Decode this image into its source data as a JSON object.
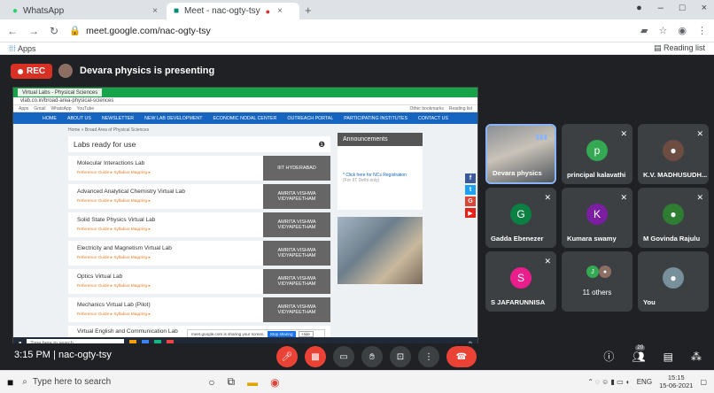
{
  "browser": {
    "tabs": [
      {
        "title": "WhatsApp",
        "close": "×"
      },
      {
        "title": "Meet - nac-ogty-tsy",
        "close": "×"
      }
    ],
    "new_tab": "+",
    "window_controls": [
      "–",
      "□",
      "×"
    ],
    "url": "meet.google.com/nac-ogty-tsy",
    "bookmarks_apps": "Apps",
    "reading_list": "Reading list"
  },
  "meet": {
    "rec_label": "REC",
    "presenting_text": "Devara physics is presenting",
    "meeting_time": "3:15 PM",
    "meeting_code": "nac-ogty-tsy",
    "people_count": "20"
  },
  "shared_screen": {
    "tab1": "Virtual Labs - Physical Sciences",
    "address": "vlab.co.in/broad-area-physical-sciences",
    "bookmarks": [
      "Apps",
      "Gmail",
      "WhatsApp",
      "YouTube",
      "Other bookmarks",
      "Reading list"
    ],
    "nav": [
      "HOME",
      "ABOUT US",
      "NEWSLETTER",
      "NEW LAB DEVELOPMENT",
      "ECONOMIC NODAL CENTER",
      "OUTREACH PORTAL",
      "PARTICIPATING INSTITUTES",
      "CONTACT US"
    ],
    "breadcrumb": "Home » Broad Area of Physical Sciences",
    "labs_title": "Labs ready for use",
    "labs": [
      {
        "name": "Molecular Interactions Lab",
        "sub": "Reference Guide ▸   Syllabus Mapping ▸",
        "institute": "IIIT HYDERABAD"
      },
      {
        "name": "Advanced Analytical Chemistry Virtual Lab",
        "sub": "Reference Guide ▸   Syllabus Mapping ▸",
        "institute": "AMRITA VISHWA VIDYAPEETHAM"
      },
      {
        "name": "Solid State Physics Virtual Lab",
        "sub": "Reference Guide ▸   Syllabus Mapping ▸",
        "institute": "AMRITA VISHWA VIDYAPEETHAM"
      },
      {
        "name": "Electricity and Magnetism Virtual Lab",
        "sub": "Reference Guide ▸   Syllabus Mapping ▸",
        "institute": "AMRITA VISHWA VIDYAPEETHAM"
      },
      {
        "name": "Optics Virtual Lab",
        "sub": "Reference Guide ▸   Syllabus Mapping ▸",
        "institute": "AMRITA VISHWA VIDYAPEETHAM"
      },
      {
        "name": "Mechanics Virtual Lab (Pilot)",
        "sub": "Reference Guide ▸   Syllabus Mapping ▸",
        "institute": "AMRITA VISHWA VIDYAPEETHAM"
      },
      {
        "name": "Virtual English and Communication Lab",
        "sub": "",
        "institute": ""
      }
    ],
    "announcements_title": "Announcements",
    "announcement_link": "* Click here for NCs Registration",
    "announcement_sub": "(For IIT Delhi only)",
    "share_popup": "meet.google.com is sharing your screen.",
    "stop_sharing": "Stop sharing",
    "hide": "Hide",
    "taskbar_search": "Type here to search"
  },
  "participants": [
    {
      "name": "Devara physics",
      "initial": "",
      "color": ""
    },
    {
      "name": "principal kalavathi",
      "initial": "p",
      "color": "#34a853"
    },
    {
      "name": "K.V. MADHUSUDH...",
      "initial": "",
      "color": "#5f6368"
    },
    {
      "name": "Gadda Ebenezer",
      "initial": "G",
      "color": "#0b8043"
    },
    {
      "name": "Kumara swamy",
      "initial": "K",
      "color": "#7b1fa2"
    },
    {
      "name": "M Govinda Rajulu",
      "initial": "",
      "color": "#5f6368"
    },
    {
      "name": "S JAFARUNNISA",
      "initial": "S",
      "color": "#e91e8c"
    },
    {
      "name": "11 others",
      "initial": "J",
      "color": "#34a853"
    },
    {
      "name": "You",
      "initial": "",
      "color": "#5f6368"
    }
  ],
  "windows": {
    "search_placeholder": "Type here to search",
    "lang": "ENG",
    "time": "15:15",
    "date": "15-06-2021"
  }
}
